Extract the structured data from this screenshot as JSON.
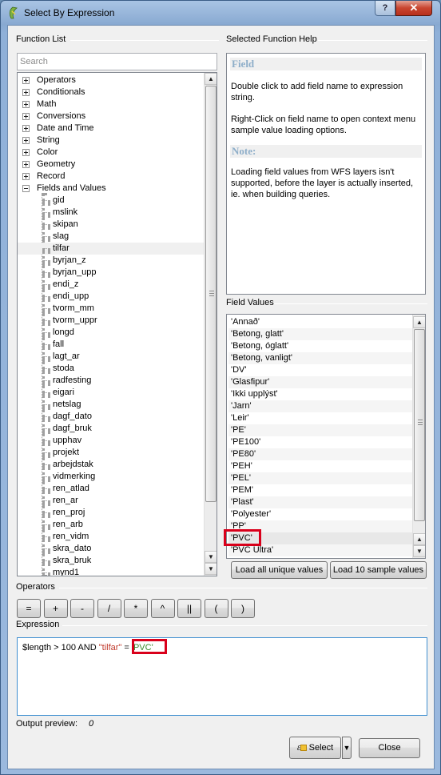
{
  "window": {
    "title": "Select By Expression",
    "help_glyph": "?",
    "close_glyph": "✕"
  },
  "function_list": {
    "label": "Function List",
    "search_placeholder": "Search",
    "groups": [
      "Operators",
      "Conditionals",
      "Math",
      "Conversions",
      "Date and Time",
      "String",
      "Color",
      "Geometry",
      "Record",
      "Fields and Values"
    ],
    "fields": [
      "gid",
      "mslink",
      "skipan",
      "slag",
      "tilfar",
      "byrjan_z",
      "byrjan_upp",
      "endi_z",
      "endi_upp",
      "tvorm_mm",
      "tvorm_uppr",
      "longd",
      "fall",
      "lagt_ar",
      "stoda",
      "radfesting",
      "eigari",
      "netslag",
      "dagf_dato",
      "dagf_bruk",
      "upphav",
      "projekt",
      "arbejdstak",
      "vidmerking",
      "ren_atlad",
      "ren_ar",
      "ren_proj",
      "ren_arb",
      "ren_vidm",
      "skra_dato",
      "skra_bruk",
      "mynd1"
    ],
    "selected_field": "tilfar"
  },
  "help": {
    "section_label": "Selected Function Help",
    "heading": "Field",
    "text1": "Double click to add field name to expression string.",
    "text2": "Right-Click on field name to open context menu sample value loading options.",
    "note_heading": "Note:",
    "note_text": "Loading field values from WFS layers isn't supported, before the layer is actually inserted, ie. when building queries."
  },
  "field_values": {
    "label": "Field Values",
    "items": [
      "'Annað'",
      "'Betong, glatt'",
      "'Betong, óglatt'",
      "'Betong, vanligt'",
      "'DV'",
      "'Glasfipur'",
      "'Ikki upplýst'",
      "'Jarn'",
      "'Leir'",
      "'PE'",
      "'PE100'",
      "'PE80'",
      "'PEH'",
      "'PEL'",
      "'PEM'",
      "'Plast'",
      "'Polyester'",
      "'PP'",
      "'PVC'",
      "'PVC Ultra'"
    ],
    "highlighted": "'PVC'",
    "load_all_label": "Load all unique values",
    "load_10_label": "Load 10 sample values"
  },
  "operators": {
    "label": "Operators",
    "buttons": [
      "=",
      "+",
      "-",
      "/",
      "*",
      "^",
      "||",
      "(",
      ")"
    ]
  },
  "expression": {
    "label": "Expression",
    "part1": "$length > 100 AND ",
    "field": "\"tilfar\"",
    "part2": " = ",
    "value": "'PVC'"
  },
  "output_preview": {
    "label": "Output preview:",
    "value": "0"
  },
  "footer": {
    "select_label": "Select",
    "select_icon_glyph": "ε",
    "close_label": "Close"
  }
}
